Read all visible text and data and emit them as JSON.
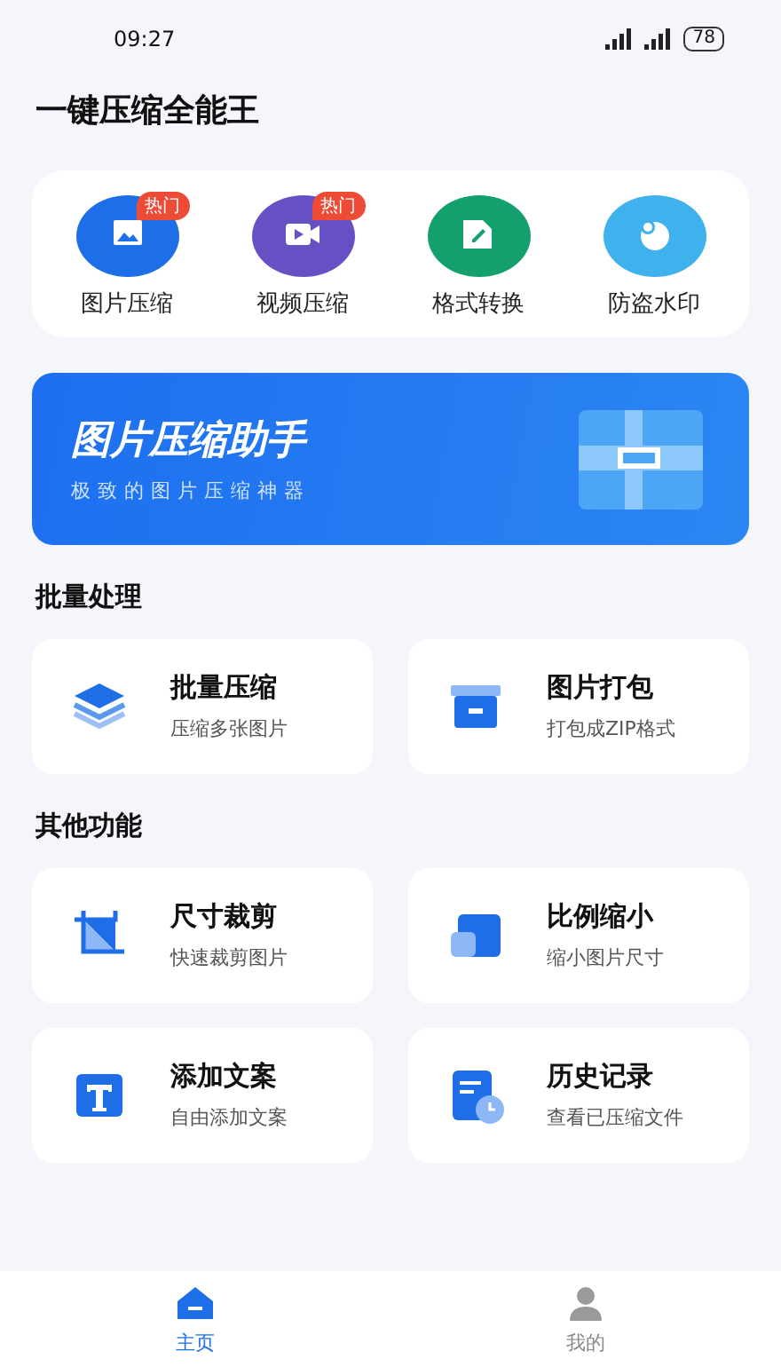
{
  "status_bar": {
    "time": "09:27",
    "battery": "78"
  },
  "app_title": "一键压缩全能王",
  "quick_tools": [
    {
      "label": "图片压缩",
      "badge": "热门",
      "color": "#1e6ee8"
    },
    {
      "label": "视频压缩",
      "badge": "热门",
      "color": "#6750c4"
    },
    {
      "label": "格式转换",
      "color": "#14a06c"
    },
    {
      "label": "防盗水印",
      "color": "#3fb1ec"
    }
  ],
  "banner": {
    "title": "图片压缩助手",
    "subtitle": "极致的图片压缩神器"
  },
  "sections": [
    {
      "title": "批量处理",
      "items": [
        {
          "title": "批量压缩",
          "subtitle": "压缩多张图片"
        },
        {
          "title": "图片打包",
          "subtitle": "打包成ZIP格式"
        }
      ]
    },
    {
      "title": "其他功能",
      "items": [
        {
          "title": "尺寸裁剪",
          "subtitle": "快速裁剪图片"
        },
        {
          "title": "比例缩小",
          "subtitle": "缩小图片尺寸"
        },
        {
          "title": "添加文案",
          "subtitle": "自由添加文案"
        },
        {
          "title": "历史记录",
          "subtitle": "查看已压缩文件"
        }
      ]
    }
  ],
  "bottom_nav": [
    {
      "label": "主页",
      "selected": true
    },
    {
      "label": "我的",
      "selected": false
    }
  ]
}
